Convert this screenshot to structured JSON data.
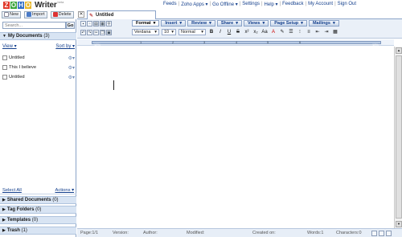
{
  "app": {
    "logo_letters": [
      "Z",
      "O",
      "H",
      "O"
    ],
    "logo_colors": [
      "#e0392a",
      "#3aa33a",
      "#2e6cc7",
      "#e8b72a"
    ],
    "name": "Writer",
    "beta": "beta"
  },
  "topnav": [
    "Feeds",
    "Zoho Apps ▾",
    "Go Offline ▾",
    "Settings",
    "Help ▾",
    "Feedback",
    "My Account",
    "Sign Out"
  ],
  "left_toolbar": {
    "new_label": "New",
    "import_label": "Import",
    "delete_label": "Delete"
  },
  "search": {
    "placeholder": "Search...",
    "go_label": "Go"
  },
  "my_documents": {
    "label": "My Documents",
    "count": "(3)"
  },
  "view_label": "View ▾",
  "sortby_label": "Sort by ▾",
  "documents": [
    {
      "name": "Untitled"
    },
    {
      "name": "This I believe"
    },
    {
      "name": "Untitled"
    }
  ],
  "select_all": "Select All",
  "actions": "Actions ▾",
  "sections": [
    {
      "label": "Shared Documents",
      "count": "(0)"
    },
    {
      "label": "Tag Folders",
      "count": "(0)"
    },
    {
      "label": "Templates",
      "count": "(0)"
    },
    {
      "label": "Trash",
      "count": "(1)"
    }
  ],
  "tab": {
    "title": "Untitled"
  },
  "menu_tabs": [
    "Format",
    "Insert",
    "Review",
    "Share",
    "Views",
    "Page Setup",
    "Mailings"
  ],
  "format": {
    "font": "Verdana",
    "size": "10",
    "style": "Normal"
  },
  "ruler": {
    "left": "10%",
    "right": "10%",
    "numbers": [
      "1",
      "2",
      "3",
      "4",
      "5",
      "6"
    ]
  },
  "status": {
    "page_label": "Page:",
    "page_value": "1/1",
    "version_label": "Version:",
    "author_label": "Author:",
    "modified_label": "Modified:",
    "created_label": "Created on:",
    "words_label": "Words:",
    "words_value": "1",
    "chars_label": "Characters:",
    "chars_value": "0"
  }
}
